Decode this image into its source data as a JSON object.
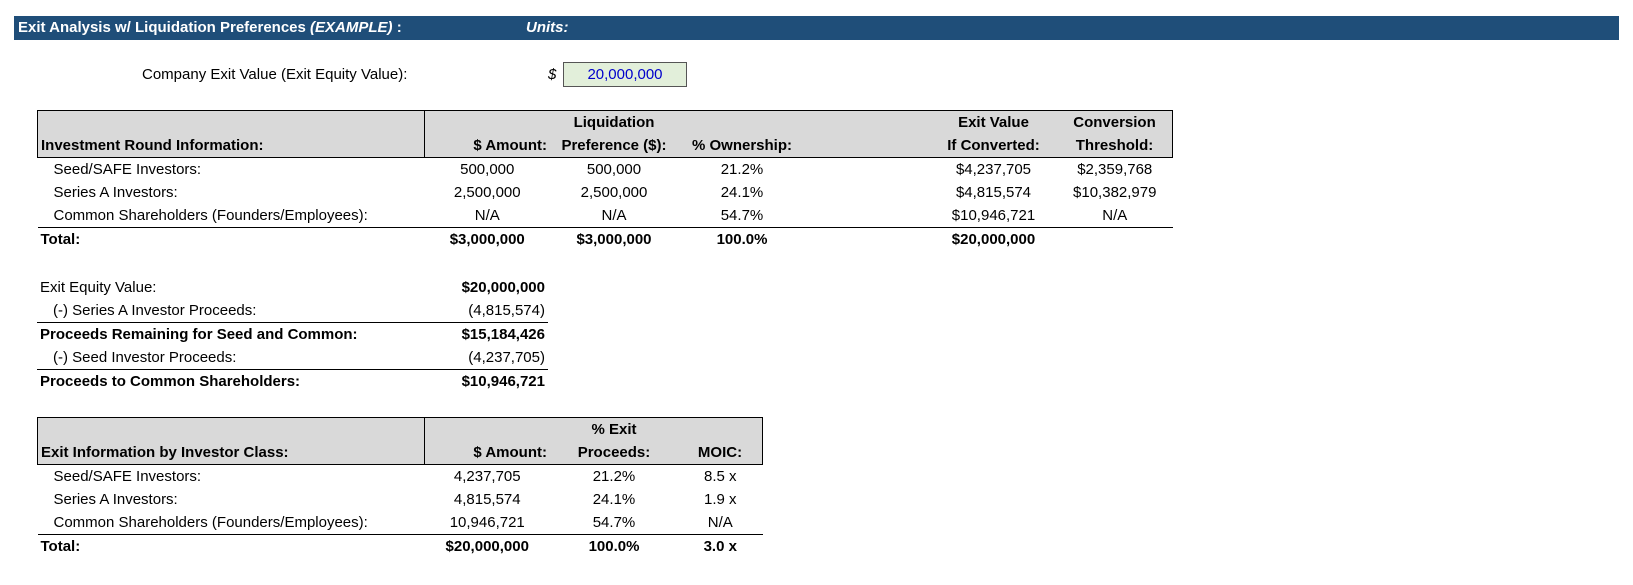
{
  "header": {
    "title": "Exit Analysis w/ Liquidation Preferences",
    "title_example": "(EXAMPLE)",
    "title_suffix": " :",
    "units_label": "Units:"
  },
  "exit_input": {
    "label": "Company Exit Value (Exit Equity Value):",
    "currency": "$",
    "value": "20,000,000"
  },
  "round_table": {
    "headers_top": [
      "",
      "",
      "Liquidation",
      "",
      "",
      "Exit Value",
      "Conversion"
    ],
    "headers_bottom": [
      "Investment Round Information:",
      "$ Amount:",
      "Preference ($):",
      "% Ownership:",
      "",
      "If Converted:",
      "Threshold:"
    ],
    "rows": [
      [
        "Seed/SAFE Investors:",
        "500,000",
        "500,000",
        "21.2%",
        "",
        "$4,237,705",
        "$2,359,768"
      ],
      [
        "Series A Investors:",
        "2,500,000",
        "2,500,000",
        "24.1%",
        "",
        "$4,815,574",
        "$10,382,979"
      ],
      [
        "Common Shareholders (Founders/Employees):",
        "N/A",
        "N/A",
        "54.7%",
        "",
        "$10,946,721",
        "N/A"
      ]
    ],
    "total": [
      "Total:",
      "$3,000,000",
      "$3,000,000",
      "100.0%",
      "",
      "$20,000,000",
      ""
    ]
  },
  "waterfall": {
    "rows": [
      {
        "label": "Exit Equity Value:",
        "value": "$20,000,000"
      },
      {
        "label": "(-) Series A Investor Proceeds:",
        "value": "(4,815,574)"
      },
      {
        "label": "Proceeds Remaining for Seed and Common:",
        "value": "$15,184,426"
      },
      {
        "label": "(-) Seed Investor Proceeds:",
        "value": "(4,237,705)"
      },
      {
        "label": "Proceeds to Common Shareholders:",
        "value": "$10,946,721"
      }
    ]
  },
  "exit_table": {
    "headers_top": [
      "",
      "",
      "% Exit",
      ""
    ],
    "headers_bottom": [
      "Exit Information by Investor Class:",
      "$ Amount:",
      "Proceeds:",
      "MOIC:"
    ],
    "rows": [
      [
        "Seed/SAFE Investors:",
        "4,237,705",
        "21.2%",
        "8.5 x"
      ],
      [
        "Series A Investors:",
        "4,815,574",
        "24.1%",
        "1.9 x"
      ],
      [
        "Common Shareholders (Founders/Employees):",
        "10,946,721",
        "54.7%",
        "N/A"
      ]
    ],
    "total": [
      "Total:",
      "$20,000,000",
      "100.0%",
      "3.0 x"
    ]
  },
  "colors": {
    "title_bar": "#1f4e79",
    "header_fill": "#d9d9d9",
    "input_fill": "#e2efda",
    "input_text": "#0000cc"
  }
}
